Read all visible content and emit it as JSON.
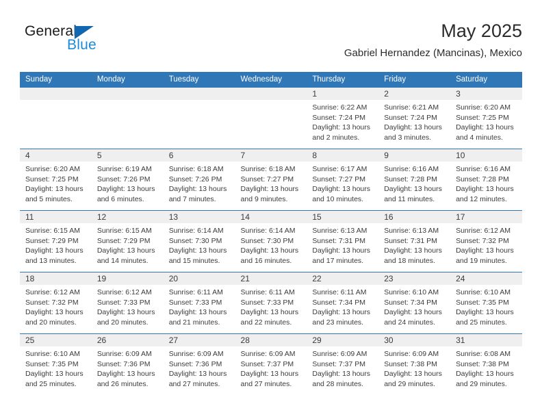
{
  "brand": {
    "name_part1": "General",
    "name_part2": "Blue",
    "triangle_icon": "triangle-icon",
    "accent_dark": "#1267b1",
    "accent_light": "#1c8adb"
  },
  "header": {
    "title": "May 2025",
    "subtitle": "Gabriel Hernandez (Mancinas), Mexico"
  },
  "calendar": {
    "header_bg": "#3077b8",
    "daynum_bg": "#efefef",
    "weekday_headers": [
      "Sunday",
      "Monday",
      "Tuesday",
      "Wednesday",
      "Thursday",
      "Friday",
      "Saturday"
    ],
    "weeks": [
      [
        {
          "day": "",
          "sunrise": "",
          "sunset": "",
          "daylight_line1": "",
          "daylight_line2": ""
        },
        {
          "day": "",
          "sunrise": "",
          "sunset": "",
          "daylight_line1": "",
          "daylight_line2": ""
        },
        {
          "day": "",
          "sunrise": "",
          "sunset": "",
          "daylight_line1": "",
          "daylight_line2": ""
        },
        {
          "day": "",
          "sunrise": "",
          "sunset": "",
          "daylight_line1": "",
          "daylight_line2": ""
        },
        {
          "day": "1",
          "sunrise": "Sunrise: 6:22 AM",
          "sunset": "Sunset: 7:24 PM",
          "daylight_line1": "Daylight: 13 hours",
          "daylight_line2": "and 2 minutes."
        },
        {
          "day": "2",
          "sunrise": "Sunrise: 6:21 AM",
          "sunset": "Sunset: 7:24 PM",
          "daylight_line1": "Daylight: 13 hours",
          "daylight_line2": "and 3 minutes."
        },
        {
          "day": "3",
          "sunrise": "Sunrise: 6:20 AM",
          "sunset": "Sunset: 7:25 PM",
          "daylight_line1": "Daylight: 13 hours",
          "daylight_line2": "and 4 minutes."
        }
      ],
      [
        {
          "day": "4",
          "sunrise": "Sunrise: 6:20 AM",
          "sunset": "Sunset: 7:25 PM",
          "daylight_line1": "Daylight: 13 hours",
          "daylight_line2": "and 5 minutes."
        },
        {
          "day": "5",
          "sunrise": "Sunrise: 6:19 AM",
          "sunset": "Sunset: 7:26 PM",
          "daylight_line1": "Daylight: 13 hours",
          "daylight_line2": "and 6 minutes."
        },
        {
          "day": "6",
          "sunrise": "Sunrise: 6:18 AM",
          "sunset": "Sunset: 7:26 PM",
          "daylight_line1": "Daylight: 13 hours",
          "daylight_line2": "and 7 minutes."
        },
        {
          "day": "7",
          "sunrise": "Sunrise: 6:18 AM",
          "sunset": "Sunset: 7:27 PM",
          "daylight_line1": "Daylight: 13 hours",
          "daylight_line2": "and 9 minutes."
        },
        {
          "day": "8",
          "sunrise": "Sunrise: 6:17 AM",
          "sunset": "Sunset: 7:27 PM",
          "daylight_line1": "Daylight: 13 hours",
          "daylight_line2": "and 10 minutes."
        },
        {
          "day": "9",
          "sunrise": "Sunrise: 6:16 AM",
          "sunset": "Sunset: 7:28 PM",
          "daylight_line1": "Daylight: 13 hours",
          "daylight_line2": "and 11 minutes."
        },
        {
          "day": "10",
          "sunrise": "Sunrise: 6:16 AM",
          "sunset": "Sunset: 7:28 PM",
          "daylight_line1": "Daylight: 13 hours",
          "daylight_line2": "and 12 minutes."
        }
      ],
      [
        {
          "day": "11",
          "sunrise": "Sunrise: 6:15 AM",
          "sunset": "Sunset: 7:29 PM",
          "daylight_line1": "Daylight: 13 hours",
          "daylight_line2": "and 13 minutes."
        },
        {
          "day": "12",
          "sunrise": "Sunrise: 6:15 AM",
          "sunset": "Sunset: 7:29 PM",
          "daylight_line1": "Daylight: 13 hours",
          "daylight_line2": "and 14 minutes."
        },
        {
          "day": "13",
          "sunrise": "Sunrise: 6:14 AM",
          "sunset": "Sunset: 7:30 PM",
          "daylight_line1": "Daylight: 13 hours",
          "daylight_line2": "and 15 minutes."
        },
        {
          "day": "14",
          "sunrise": "Sunrise: 6:14 AM",
          "sunset": "Sunset: 7:30 PM",
          "daylight_line1": "Daylight: 13 hours",
          "daylight_line2": "and 16 minutes."
        },
        {
          "day": "15",
          "sunrise": "Sunrise: 6:13 AM",
          "sunset": "Sunset: 7:31 PM",
          "daylight_line1": "Daylight: 13 hours",
          "daylight_line2": "and 17 minutes."
        },
        {
          "day": "16",
          "sunrise": "Sunrise: 6:13 AM",
          "sunset": "Sunset: 7:31 PM",
          "daylight_line1": "Daylight: 13 hours",
          "daylight_line2": "and 18 minutes."
        },
        {
          "day": "17",
          "sunrise": "Sunrise: 6:12 AM",
          "sunset": "Sunset: 7:32 PM",
          "daylight_line1": "Daylight: 13 hours",
          "daylight_line2": "and 19 minutes."
        }
      ],
      [
        {
          "day": "18",
          "sunrise": "Sunrise: 6:12 AM",
          "sunset": "Sunset: 7:32 PM",
          "daylight_line1": "Daylight: 13 hours",
          "daylight_line2": "and 20 minutes."
        },
        {
          "day": "19",
          "sunrise": "Sunrise: 6:12 AM",
          "sunset": "Sunset: 7:33 PM",
          "daylight_line1": "Daylight: 13 hours",
          "daylight_line2": "and 20 minutes."
        },
        {
          "day": "20",
          "sunrise": "Sunrise: 6:11 AM",
          "sunset": "Sunset: 7:33 PM",
          "daylight_line1": "Daylight: 13 hours",
          "daylight_line2": "and 21 minutes."
        },
        {
          "day": "21",
          "sunrise": "Sunrise: 6:11 AM",
          "sunset": "Sunset: 7:33 PM",
          "daylight_line1": "Daylight: 13 hours",
          "daylight_line2": "and 22 minutes."
        },
        {
          "day": "22",
          "sunrise": "Sunrise: 6:11 AM",
          "sunset": "Sunset: 7:34 PM",
          "daylight_line1": "Daylight: 13 hours",
          "daylight_line2": "and 23 minutes."
        },
        {
          "day": "23",
          "sunrise": "Sunrise: 6:10 AM",
          "sunset": "Sunset: 7:34 PM",
          "daylight_line1": "Daylight: 13 hours",
          "daylight_line2": "and 24 minutes."
        },
        {
          "day": "24",
          "sunrise": "Sunrise: 6:10 AM",
          "sunset": "Sunset: 7:35 PM",
          "daylight_line1": "Daylight: 13 hours",
          "daylight_line2": "and 25 minutes."
        }
      ],
      [
        {
          "day": "25",
          "sunrise": "Sunrise: 6:10 AM",
          "sunset": "Sunset: 7:35 PM",
          "daylight_line1": "Daylight: 13 hours",
          "daylight_line2": "and 25 minutes."
        },
        {
          "day": "26",
          "sunrise": "Sunrise: 6:09 AM",
          "sunset": "Sunset: 7:36 PM",
          "daylight_line1": "Daylight: 13 hours",
          "daylight_line2": "and 26 minutes."
        },
        {
          "day": "27",
          "sunrise": "Sunrise: 6:09 AM",
          "sunset": "Sunset: 7:36 PM",
          "daylight_line1": "Daylight: 13 hours",
          "daylight_line2": "and 27 minutes."
        },
        {
          "day": "28",
          "sunrise": "Sunrise: 6:09 AM",
          "sunset": "Sunset: 7:37 PM",
          "daylight_line1": "Daylight: 13 hours",
          "daylight_line2": "and 27 minutes."
        },
        {
          "day": "29",
          "sunrise": "Sunrise: 6:09 AM",
          "sunset": "Sunset: 7:37 PM",
          "daylight_line1": "Daylight: 13 hours",
          "daylight_line2": "and 28 minutes."
        },
        {
          "day": "30",
          "sunrise": "Sunrise: 6:09 AM",
          "sunset": "Sunset: 7:38 PM",
          "daylight_line1": "Daylight: 13 hours",
          "daylight_line2": "and 29 minutes."
        },
        {
          "day": "31",
          "sunrise": "Sunrise: 6:08 AM",
          "sunset": "Sunset: 7:38 PM",
          "daylight_line1": "Daylight: 13 hours",
          "daylight_line2": "and 29 minutes."
        }
      ]
    ]
  }
}
